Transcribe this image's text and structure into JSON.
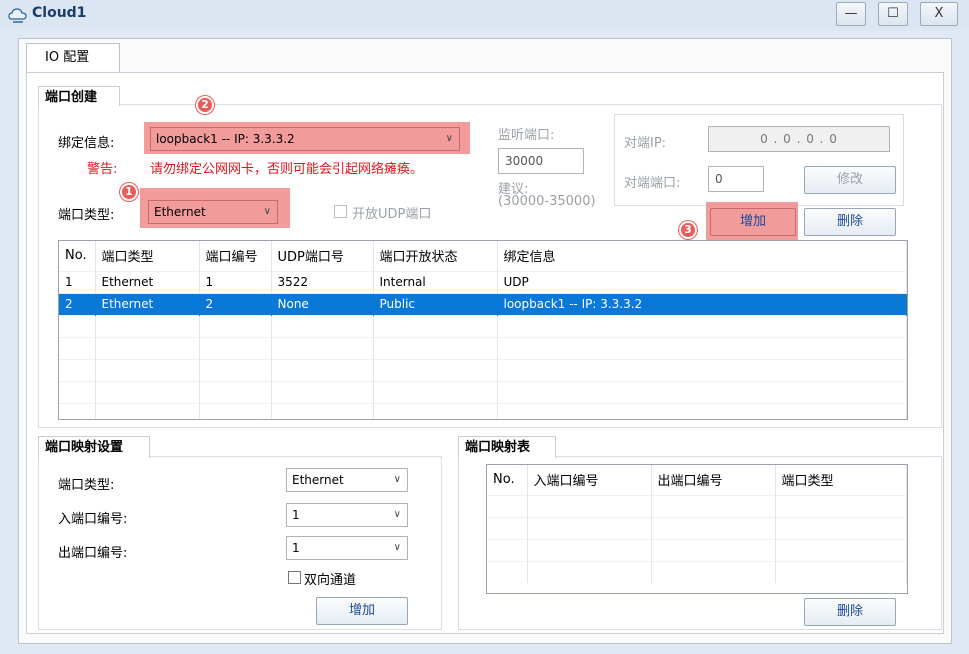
{
  "window": {
    "title": "Cloud1",
    "minimize": "—",
    "maximize": "☐",
    "close": "X"
  },
  "tabs": [
    {
      "label": "IO 配置"
    }
  ],
  "port_create": {
    "section_title": "端口创建",
    "bind_label": "绑定信息:",
    "bind_value": "loopback1 -- IP: 3.3.3.2",
    "warning_label": "警告:",
    "warning_text": "请勿绑定公网网卡，否则可能会引起网络瘫痪。",
    "port_type_label": "端口类型:",
    "port_type_value": "Ethernet",
    "open_udp_label": "开放UDP端口",
    "listen_port_label": "监听端口:",
    "listen_port_value": "30000",
    "suggest_label": "建议:",
    "suggest_range": "(30000-35000)",
    "peer_ip_label": "对端IP:",
    "peer_ip_value": "0 . 0 . 0 . 0",
    "peer_port_label": "对端端口:",
    "peer_port_value": "0",
    "modify_button": "修改",
    "add_button": "增加",
    "delete_button": "删除",
    "badges": [
      "1",
      "2",
      "3"
    ]
  },
  "port_table": {
    "columns": [
      "No.",
      "端口类型",
      "端口编号",
      "UDP端口号",
      "端口开放状态",
      "绑定信息"
    ],
    "rows": [
      [
        "1",
        "Ethernet",
        "1",
        "3522",
        "Internal",
        "UDP"
      ],
      [
        "2",
        "Ethernet",
        "2",
        "None",
        "Public",
        "loopback1 -- IP: 3.3.3.2"
      ]
    ],
    "selected_row": 2
  },
  "mapping_settings": {
    "section_title": "端口映射设置",
    "port_type_label": "端口类型:",
    "port_type_value": "Ethernet",
    "in_port_label": "入端口编号:",
    "in_port_value": "1",
    "out_port_label": "出端口编号:",
    "out_port_value": "1",
    "bidirectional_label": "双向通道",
    "add_button": "增加"
  },
  "mapping_table": {
    "section_title": "端口映射表",
    "columns": [
      "No.",
      "入端口编号",
      "出端口编号",
      "端口类型"
    ],
    "delete_button": "删除"
  },
  "colors": {
    "highlight": "#ef8a8a",
    "selection": "#0a78d7",
    "warning": "#e0141b"
  }
}
